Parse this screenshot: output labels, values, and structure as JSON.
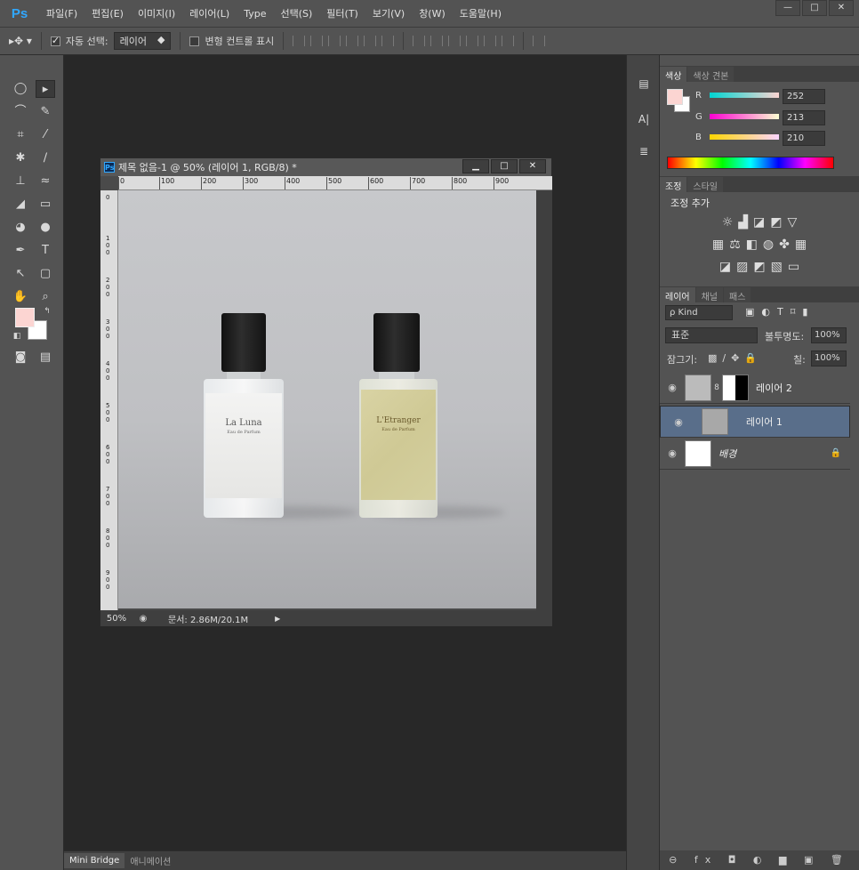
{
  "app": {
    "logo": "Ps"
  },
  "menubar": {
    "items": [
      "파일(F)",
      "편집(E)",
      "이미지(I)",
      "레이어(L)",
      "Type",
      "선택(S)",
      "필터(T)",
      "보기(V)",
      "창(W)",
      "도움말(H)"
    ],
    "win_min": "—",
    "win_max": "□",
    "win_close": "✕"
  },
  "options": {
    "auto_select_label": "자동 선택:",
    "auto_select_value": "레이어",
    "transform_label": "변형 컨트롤 표시"
  },
  "document": {
    "title": "제목 없음-1 @ 50% (레이어 1, RGB/8) *",
    "ruler_top": [
      "0",
      "100",
      "200",
      "300",
      "400",
      "500",
      "600",
      "700",
      "800",
      "900"
    ],
    "ruler_left": [
      "0",
      "100",
      "200",
      "300",
      "400",
      "500",
      "600",
      "700",
      "800",
      "900"
    ],
    "zoom": "50%",
    "doc_info": "문서: 2.86M/20.1M",
    "bottle1_label_title": "La Luna",
    "bottle1_label_sub": "Eau de Parfum",
    "bottle2_label_title": "L'Etranger",
    "bottle2_label_sub": "Eau de Parfum"
  },
  "color_panel": {
    "tabs": [
      "색상",
      "색상 견본"
    ],
    "r_label": "R",
    "g_label": "G",
    "b_label": "B",
    "r": "252",
    "g": "213",
    "b": "210",
    "fg_color": "#fcd5d2"
  },
  "adjust_panel": {
    "tabs": [
      "조정",
      "스타일"
    ],
    "heading": "조정 추가"
  },
  "layers_panel": {
    "tabs": [
      "레이어",
      "채널",
      "패스"
    ],
    "filter_kind": "ρ Kind",
    "blend_mode": "표준",
    "opacity_label": "불투명도:",
    "opacity_value": "100%",
    "lock_label": "잠그기:",
    "fill_label": "칠:",
    "fill_value": "100%",
    "layers": [
      {
        "name": "레이어 2"
      },
      {
        "name": "레이어 1"
      },
      {
        "name": "배경"
      }
    ]
  },
  "bottom": {
    "tabs": [
      "Mini Bridge",
      "애니메이션"
    ]
  }
}
